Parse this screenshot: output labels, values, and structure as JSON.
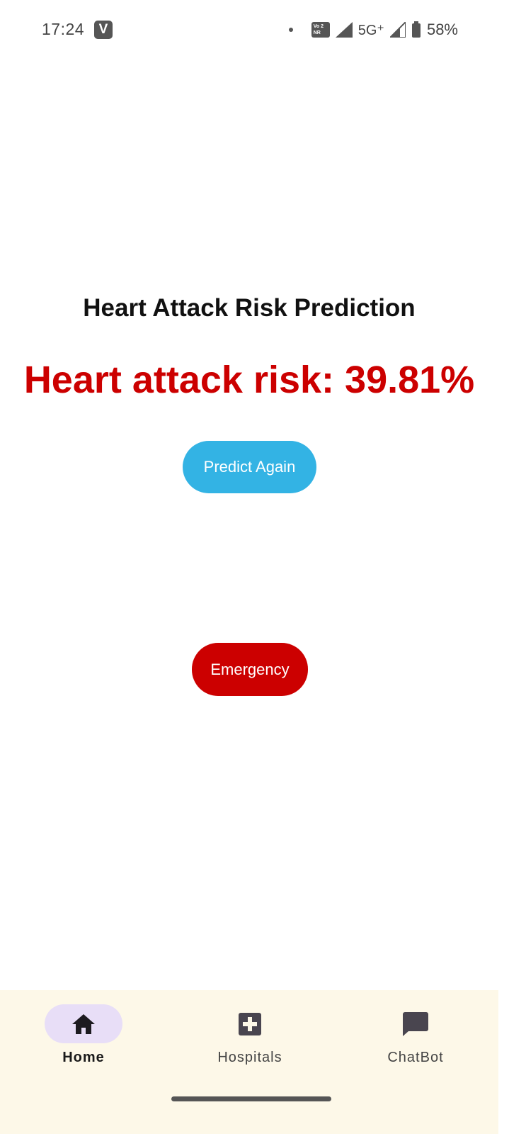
{
  "status_bar": {
    "time": "17:24",
    "app_icon_letter": "V",
    "volte_top": "Vo 2",
    "volte_bottom": "NR",
    "network": "5G⁺",
    "battery": "58%"
  },
  "main": {
    "title": "Heart Attack Risk Prediction",
    "risk_text": "Heart attack risk: 39.81%",
    "predict_button_label": "Predict Again",
    "emergency_button_label": "Emergency"
  },
  "bottom_nav": {
    "items": [
      {
        "label": "Home",
        "icon": "home-icon",
        "active": true
      },
      {
        "label": "Hospitals",
        "icon": "hospital-cross-icon",
        "active": false
      },
      {
        "label": "ChatBot",
        "icon": "chat-bubble-icon",
        "active": false
      }
    ]
  },
  "colors": {
    "risk_red": "#cc0000",
    "predict_blue": "#33b3e4",
    "nav_background": "#fdf8e8",
    "nav_active_pill": "#e8def7"
  }
}
